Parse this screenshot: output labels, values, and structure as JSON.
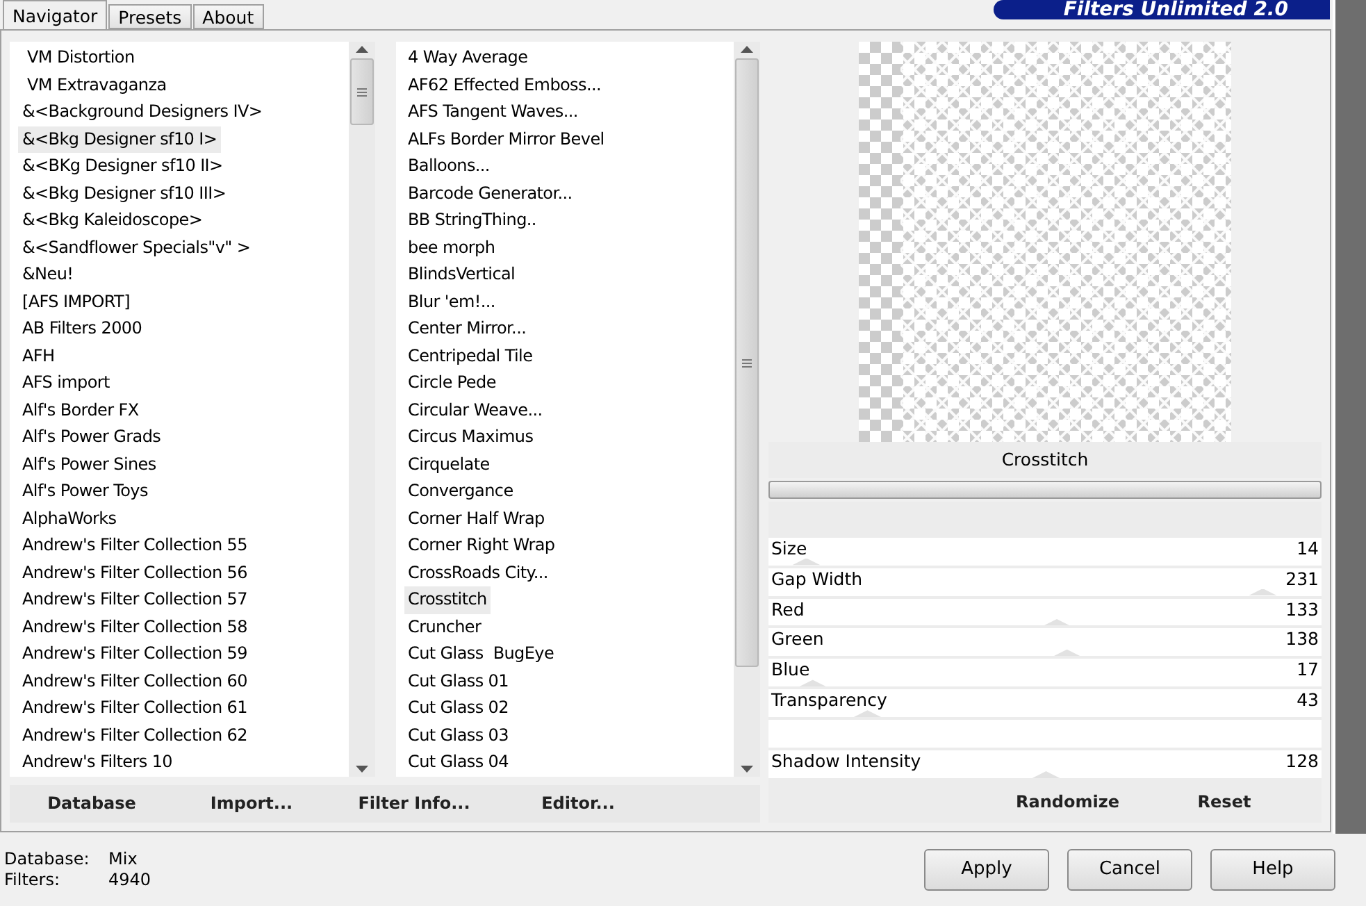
{
  "tabs": [
    {
      "label": "Navigator",
      "selected": true
    },
    {
      "label": "Presets",
      "selected": false
    },
    {
      "label": "About",
      "selected": false
    }
  ],
  "logo": "Filters Unlimited 2.0",
  "categories": [
    {
      "label": " VM Distortion",
      "selected": false
    },
    {
      "label": " VM Extravaganza",
      "selected": false
    },
    {
      "label": "&<Background Designers IV>",
      "selected": false
    },
    {
      "label": "&<Bkg Designer sf10 I>",
      "selected": true
    },
    {
      "label": "&<BKg Designer sf10 II>",
      "selected": false
    },
    {
      "label": "&<Bkg Designer sf10 III>",
      "selected": false
    },
    {
      "label": "&<Bkg Kaleidoscope>",
      "selected": false
    },
    {
      "label": "&<Sandflower Specials\"v\" >",
      "selected": false
    },
    {
      "label": "&Neu!",
      "selected": false
    },
    {
      "label": "[AFS IMPORT]",
      "selected": false
    },
    {
      "label": "AB Filters 2000",
      "selected": false
    },
    {
      "label": "AFH",
      "selected": false
    },
    {
      "label": "AFS import",
      "selected": false
    },
    {
      "label": "Alf's Border FX",
      "selected": false
    },
    {
      "label": "Alf's Power Grads",
      "selected": false
    },
    {
      "label": "Alf's Power Sines",
      "selected": false
    },
    {
      "label": "Alf's Power Toys",
      "selected": false
    },
    {
      "label": "AlphaWorks",
      "selected": false
    },
    {
      "label": "Andrew's Filter Collection 55",
      "selected": false
    },
    {
      "label": "Andrew's Filter Collection 56",
      "selected": false
    },
    {
      "label": "Andrew's Filter Collection 57",
      "selected": false
    },
    {
      "label": "Andrew's Filter Collection 58",
      "selected": false
    },
    {
      "label": "Andrew's Filter Collection 59",
      "selected": false
    },
    {
      "label": "Andrew's Filter Collection 60",
      "selected": false
    },
    {
      "label": "Andrew's Filter Collection 61",
      "selected": false
    },
    {
      "label": "Andrew's Filter Collection 62",
      "selected": false
    },
    {
      "label": "Andrew's Filters 10",
      "selected": false
    }
  ],
  "filters": [
    {
      "label": "4 Way Average",
      "selected": false
    },
    {
      "label": "AF62 Effected Emboss...",
      "selected": false
    },
    {
      "label": "AFS Tangent Waves...",
      "selected": false
    },
    {
      "label": "ALFs Border Mirror Bevel",
      "selected": false
    },
    {
      "label": "Balloons...",
      "selected": false
    },
    {
      "label": "Barcode Generator...",
      "selected": false
    },
    {
      "label": "BB StringThing..",
      "selected": false
    },
    {
      "label": "bee morph",
      "selected": false
    },
    {
      "label": "BlindsVertical",
      "selected": false
    },
    {
      "label": "Blur 'em!...",
      "selected": false
    },
    {
      "label": "Center Mirror...",
      "selected": false
    },
    {
      "label": "Centripedal Tile",
      "selected": false
    },
    {
      "label": "Circle Pede",
      "selected": false
    },
    {
      "label": "Circular Weave...",
      "selected": false
    },
    {
      "label": "Circus Maximus",
      "selected": false
    },
    {
      "label": "Cirquelate",
      "selected": false
    },
    {
      "label": "Convergance",
      "selected": false
    },
    {
      "label": "Corner Half Wrap",
      "selected": false
    },
    {
      "label": "Corner Right Wrap",
      "selected": false
    },
    {
      "label": "CrossRoads City...",
      "selected": false
    },
    {
      "label": "Crosstitch",
      "selected": true
    },
    {
      "label": "Cruncher",
      "selected": false
    },
    {
      "label": "Cut Glass  BugEye",
      "selected": false
    },
    {
      "label": "Cut Glass 01",
      "selected": false
    },
    {
      "label": "Cut Glass 02",
      "selected": false
    },
    {
      "label": "Cut Glass 03",
      "selected": false
    },
    {
      "label": "Cut Glass 04",
      "selected": false
    }
  ],
  "list_buttons": [
    "Database",
    "Import...",
    "Filter Info...",
    "Editor..."
  ],
  "filter_title": "Crosstitch",
  "parameters": [
    {
      "kind": "slider",
      "label": "Size",
      "value": "14",
      "level": 0.055
    },
    {
      "kind": "slider",
      "label": "Gap Width",
      "value": "231",
      "level": 0.906
    },
    {
      "kind": "slider",
      "label": "Red",
      "value": "133",
      "level": 0.522
    },
    {
      "kind": "slider",
      "label": "Green",
      "value": "138",
      "level": 0.541
    },
    {
      "kind": "slider",
      "label": "Blue",
      "value": "17",
      "level": 0.067
    },
    {
      "kind": "slider",
      "label": "Transparency",
      "value": "43",
      "level": 0.169
    },
    {
      "kind": "blank"
    },
    {
      "kind": "slider",
      "label": "Shadow Intensity",
      "value": "128",
      "level": 0.502
    }
  ],
  "param_buttons": [
    "Randomize",
    "Reset"
  ],
  "status": [
    {
      "label": "Database:",
      "value": "Mix"
    },
    {
      "label": "Filters:",
      "value": "4940"
    }
  ],
  "dialog_buttons": [
    "Apply",
    "Cancel",
    "Help"
  ]
}
